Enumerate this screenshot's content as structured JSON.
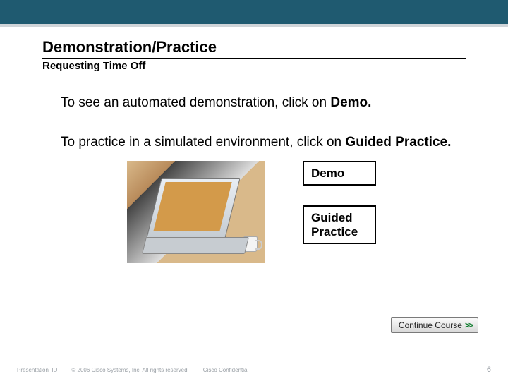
{
  "header": {
    "title": "Demonstration/Practice",
    "subtitle": "Requesting Time Off"
  },
  "body": {
    "para1_a": "To see an automated demonstration, click on ",
    "para1_b": "Demo.",
    "para2_a": "To practice in a simulated environment, click on ",
    "para2_b": "Guided Practice."
  },
  "buttons": {
    "demo": "Demo",
    "guided": "Guided Practice",
    "continue": "Continue Course",
    "continue_arrows": ">>"
  },
  "footer": {
    "pid": "Presentation_ID",
    "copyright": "© 2006 Cisco Systems, Inc. All rights reserved.",
    "confidential": "Cisco Confidential",
    "page": "6"
  }
}
